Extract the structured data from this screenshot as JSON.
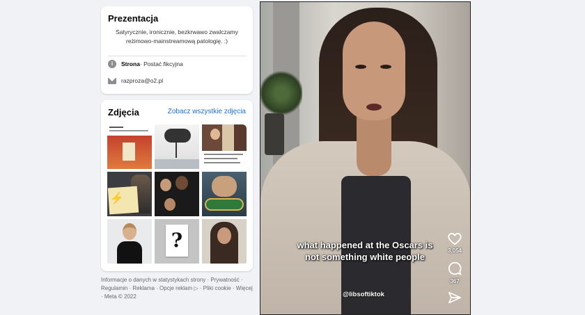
{
  "intro": {
    "title": "Prezentacja",
    "bio": "Satyrycznie, ironicznie, bezkrwawo zwalczamy reżimowo-mainstreamową patologię. :)",
    "category_label": "Strona",
    "category_value": " · Postać fikcyjna",
    "email": "razproza@o2.pl",
    "icons": [
      "info-icon",
      "mail-icon"
    ]
  },
  "photos": {
    "title": "Zdjęcia",
    "see_all": "Zobacz wszystkie zdjęcia"
  },
  "footer": {
    "text": "Informacje o danych w statystykach strony · Prywatność · Regulamin · Reklama · Opcje reklam ▷ · Pliki cookie · Więcej · Meta © 2022"
  },
  "video": {
    "caption": "what happened at the Oscars is not something white people",
    "handle": "@libsoftiktok",
    "likes": "3,054",
    "comments": "367",
    "icons": [
      "heart-icon",
      "comment-icon",
      "share-icon"
    ]
  },
  "colors": {
    "background": "#f0f2f5",
    "link": "#216fdb",
    "card": "#ffffff"
  }
}
